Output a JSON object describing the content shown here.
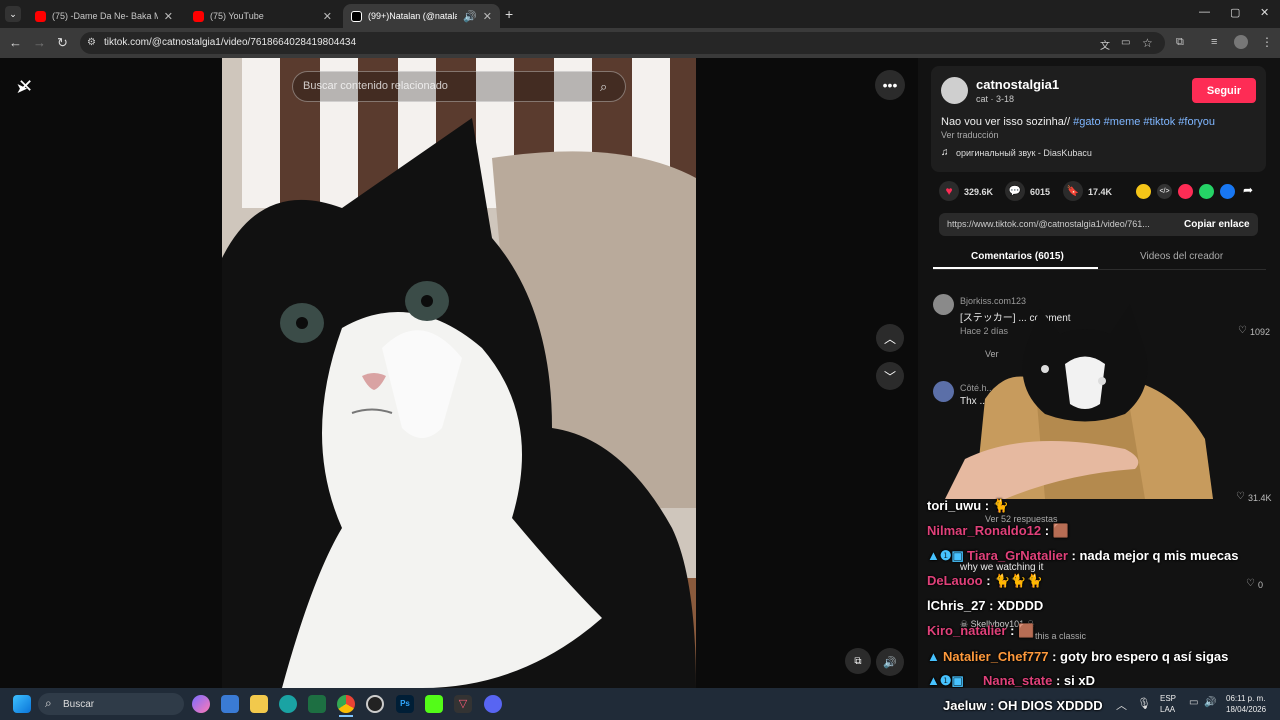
{
  "browser": {
    "tabs": [
      {
        "title": "(75) -Dame Da Ne- Baka Mitai",
        "icon": "youtube-icon",
        "color": "#ff0000",
        "active": false
      },
      {
        "title": "(75) YouTube",
        "icon": "youtube-icon",
        "color": "#ff0000",
        "active": false
      },
      {
        "title": "(99+)Natalan (@natalanx) |",
        "icon": "tiktok-icon",
        "color": "#ffffff",
        "active": true
      }
    ],
    "url": "tiktok.com/@catnostalgia1/video/7618664028419804434"
  },
  "video": {
    "search_placeholder": "Buscar contenido relacionado"
  },
  "author": {
    "username": "catnostalgia1",
    "subtitle": "cat · 3-18",
    "follow_label": "Seguir",
    "description": "Nao vou ver isso sozinha//",
    "hashtags": [
      "#gato",
      "#meme",
      "#tiktok",
      "#foryou"
    ],
    "translate_label": "Ver traducción",
    "sound": "оригинальный звук - DiasKubacu"
  },
  "stats": {
    "likes": "329.6K",
    "comments": "6015",
    "saves": "17.4K"
  },
  "share": {
    "link": "https://www.tiktok.com/@catnostalgia1/video/761...",
    "copy_label": "Copiar enlace"
  },
  "tabs": {
    "comments": "Comentarios (6015)",
    "creator": "Videos del creador"
  },
  "comments": [
    {
      "user": "Bjorkiss.com123",
      "text": "[ステッカー] ... comment",
      "meta": "Hace 2 días",
      "likes": "1092"
    },
    {
      "user": "Côté.h...",
      "text": "Thx ...",
      "likes": "31.4K"
    }
  ],
  "replies_label": "Ver 52 respuestas",
  "ver_label": "Ver",
  "extra_comments": [
    {
      "text": "why we watching it",
      "likes": "0"
    },
    {
      "user": "☠ Skellyboy101 ☠",
      "text": "this a classic"
    }
  ],
  "chat": [
    {
      "user": "tori_uwu",
      "color": "#ffffff",
      "msg": " : 🐈"
    },
    {
      "user": "Nilmar_Ronaldo12",
      "color": "#e0417a",
      "msg": " : 🟫"
    },
    {
      "user": "Tiara_GrNatalier",
      "color": "#e0417a",
      "msg": " : nada mejor q mis muecas"
    },
    {
      "user": "DeLauoo",
      "color": "#e0417a",
      "msg": " : 🐈🐈🐈"
    },
    {
      "user": "lChris_27",
      "color": "#ffffff",
      "msg": " : XDDDD"
    },
    {
      "user": "Kiro_natalier",
      "color": "#e0417a",
      "msg": " : 🟫"
    },
    {
      "user": "Natalier_Chef777",
      "color": "#ff9a3c",
      "msg": " : goty bro espero q así sigas"
    },
    {
      "user": "Nana_state",
      "color": "#e0417a",
      "msg": " : si xD"
    },
    {
      "user": "Jaeluw",
      "color": "#ffffff",
      "msg": " : OH DIOS XDDDD"
    }
  ],
  "taskbar": {
    "search_label": "Buscar",
    "lang_top": "ESP",
    "lang_bottom": "LAA",
    "time": "06:11 p. m.",
    "date": "18/04/2026"
  }
}
